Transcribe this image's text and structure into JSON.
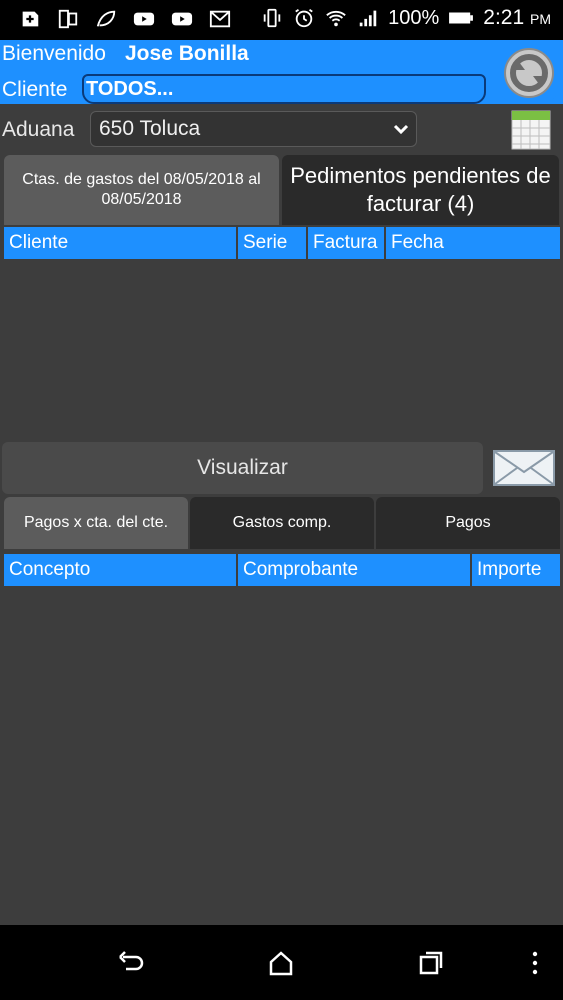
{
  "status_bar": {
    "battery_pct": "100%",
    "time": "2:21",
    "ampm": "PM"
  },
  "header": {
    "welcome": "Bienvenido",
    "user": "Jose Bonilla",
    "cliente_label": "Cliente",
    "cliente_value": "TODOS..."
  },
  "aduana": {
    "label": "Aduana",
    "selected": "650 Toluca"
  },
  "top_tabs": [
    {
      "label": "Ctas. de gastos del 08/05/2018 al 08/05/2018"
    },
    {
      "label": "Pedimentos pendientes de facturar (4)"
    }
  ],
  "table1": {
    "columns": [
      "Cliente",
      "Serie",
      "Factura",
      "Fecha"
    ]
  },
  "visualizar_label": "Visualizar",
  "bottom_tabs": [
    {
      "label": "Pagos x cta. del cte."
    },
    {
      "label": "Gastos comp."
    },
    {
      "label": "Pagos"
    }
  ],
  "table2": {
    "columns": [
      "Concepto",
      "Comprobante",
      "Importe"
    ]
  },
  "colors": {
    "accent": "#1e90ff",
    "background": "#3d3d3d",
    "tab_active": "#5c5c5c",
    "tab_inactive": "#2a2a2a"
  }
}
